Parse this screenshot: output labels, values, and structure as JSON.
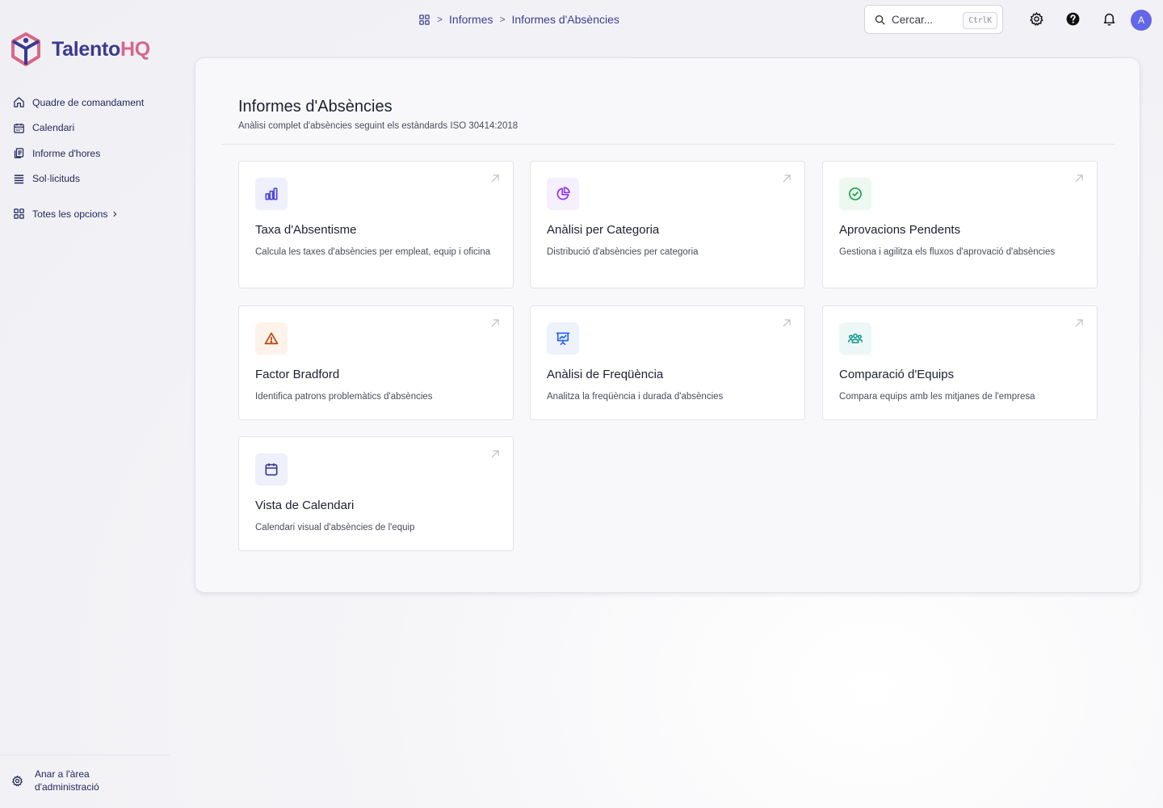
{
  "app": {
    "logo_part1": "Talento",
    "logo_part2": "HQ"
  },
  "sidebar": {
    "items": [
      {
        "label": "Quadre de comandament",
        "icon": "home-icon"
      },
      {
        "label": "Calendari",
        "icon": "calendar-icon"
      },
      {
        "label": "Informe d'hores",
        "icon": "documents-icon"
      },
      {
        "label": "Sol·licituds",
        "icon": "list-icon"
      }
    ],
    "all_options_label": "Totes les opcions",
    "admin_label": "Anar a l'àrea d'administració"
  },
  "breadcrumb": {
    "items": [
      "Informes",
      "Informes d'Absències"
    ]
  },
  "search": {
    "placeholder": "Cercar...",
    "shortcut": "CtrlK"
  },
  "user": {
    "avatar_initial": "A"
  },
  "main": {
    "title": "Informes d'Absències",
    "subtitle": "Anàlisi complet d'absències seguint els estàndards ISO 30414:2018",
    "cards": [
      {
        "title": "Taxa d'Absentisme",
        "description": "Calcula les taxes d'absències per empleat, equip i oficina",
        "icon": "bar-chart-icon",
        "accent": "#4f46e5",
        "bg": "#eef0fc"
      },
      {
        "title": "Anàlisi per Categoria",
        "description": "Distribució d'absències per categoria",
        "icon": "pie-chart-icon",
        "accent": "#9333ea",
        "bg": "#f6effd"
      },
      {
        "title": "Aprovacions Pendents",
        "description": "Gestiona i agilitza els fluxos d'aprovació d'absències",
        "icon": "check-circle-icon",
        "accent": "#16a34a",
        "bg": "#edf8f0"
      },
      {
        "title": "Factor Bradford",
        "description": "Identifica patrons problemàtics d'absències",
        "icon": "warning-icon",
        "accent": "#ea580c",
        "bg": "#fdf3ea"
      },
      {
        "title": "Anàlisi de Freqüència",
        "description": "Analitza la freqüència i durada d'absències",
        "icon": "presentation-chart-icon",
        "accent": "#2563eb",
        "bg": "#edf2fd"
      },
      {
        "title": "Comparació d'Equips",
        "description": "Compara equips amb les mitjanes de l'empresa",
        "icon": "team-icon",
        "accent": "#0d9488",
        "bg": "#edf8f6"
      },
      {
        "title": "Vista de Calendari",
        "description": "Calendari visual d'absències de l'equip",
        "icon": "calendar-icon",
        "accent": "#4f46e5",
        "bg": "#eef0fc"
      }
    ]
  }
}
